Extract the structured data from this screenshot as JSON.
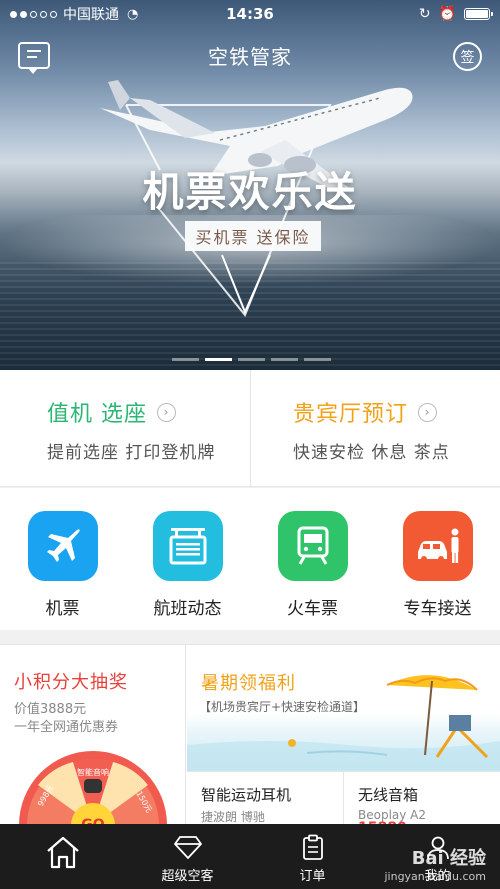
{
  "status_bar": {
    "carrier": "中国联通",
    "time": "14:36"
  },
  "header": {
    "title": "空铁管家",
    "sign_label": "签"
  },
  "banner": {
    "title": "机票欢乐送",
    "subtitle": "买机票 送保险",
    "pages": 5,
    "active_page": 1
  },
  "promo": [
    {
      "title": "值机 选座",
      "subtitle": "提前选座 打印登机牌",
      "color": "#2bb673"
    },
    {
      "title": "贵宾厅预订",
      "subtitle": "快速安检 休息 茶点",
      "color": "#f0a21a"
    }
  ],
  "services": [
    {
      "label": "机票",
      "icon": "airplane-icon",
      "color": "#1aa3f0"
    },
    {
      "label": "航班动态",
      "icon": "flight-board-icon",
      "color": "#23bde0"
    },
    {
      "label": "火车票",
      "icon": "train-icon",
      "color": "#2fc46a"
    },
    {
      "label": "专车接送",
      "icon": "car-driver-icon",
      "color": "#f25a33"
    }
  ],
  "lottery": {
    "title": "小积分大抽奖",
    "line1": "价值3888元",
    "line2": "一年全网通优惠券",
    "wheel_label": "智能音响",
    "wheel_left": "998元",
    "wheel_right": "150元",
    "wheel_center": "GO"
  },
  "summer": {
    "title": "暑期领福利",
    "subtitle": "【机场贵宾厅+快速安检通道】"
  },
  "products": [
    {
      "name": "智能运动耳机",
      "brand": "捷波朗 博驰",
      "price": ""
    },
    {
      "name": "无线音箱",
      "brand": "Beoplay A2",
      "price": "15880"
    }
  ],
  "tabs": [
    {
      "label": "",
      "icon": "home-icon"
    },
    {
      "label": "超级空客",
      "icon": "diamond-icon"
    },
    {
      "label": "订单",
      "icon": "clipboard-icon"
    },
    {
      "label": "我的",
      "icon": "user-icon"
    }
  ],
  "watermark": {
    "brand": "Bai 经验",
    "url": "jingyan.baidu.com"
  }
}
